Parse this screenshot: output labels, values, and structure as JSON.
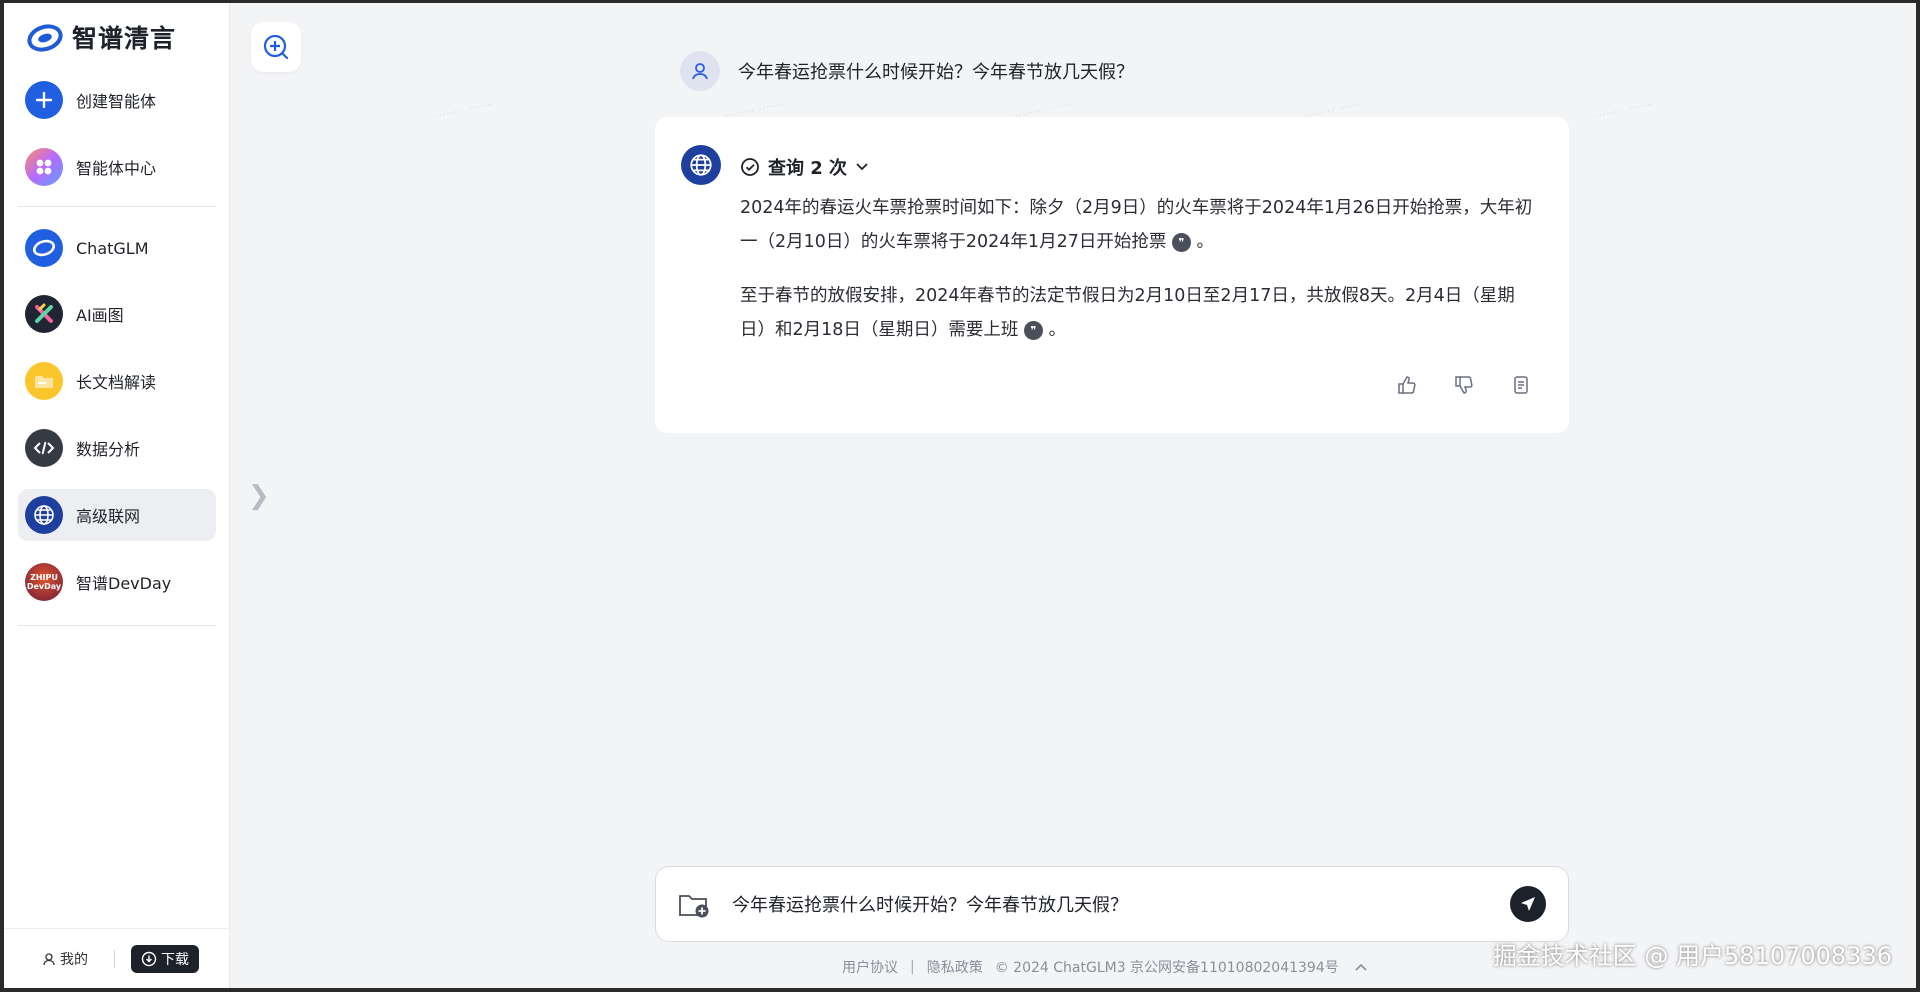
{
  "app": {
    "logo_text": "智谱清言"
  },
  "sidebar": {
    "items": [
      {
        "label": "创建智能体",
        "icon": "plus-icon"
      },
      {
        "label": "智能体中心",
        "icon": "agent-center-icon"
      },
      {
        "label": "ChatGLM",
        "icon": "chatglm-icon"
      },
      {
        "label": "AI画图",
        "icon": "ai-draw-icon"
      },
      {
        "label": "长文档解读",
        "icon": "folder-icon"
      },
      {
        "label": "数据分析",
        "icon": "code-icon"
      },
      {
        "label": "高级联网",
        "icon": "globe-icon",
        "active": true
      },
      {
        "label": "智谱DevDay",
        "icon": "devday-icon",
        "badge": "ZHIPU DevDay"
      }
    ],
    "me_label": "我的",
    "download_label": "下载"
  },
  "chat": {
    "user_message": "今年春运抢票什么时候开始？今年春节放几天假？",
    "query_label": "查询 2 次",
    "answer": {
      "para1": "2024年的春运火车票抢票时间如下：除夕（2月9日）的火车票将于2024年1月26日开始抢票，大年初一（2月10日）的火车票将于2024年1月27日开始抢票",
      "para2": "至于春节的放假安排，2024年春节的法定节假日为2月10日至2月17日，共放假8天。2月4日（星期日）和2月18日（星期日）需要上班",
      "end_mark": "。"
    }
  },
  "input": {
    "value": "今年春运抢票什么时候开始？今年春节放几天假？"
  },
  "footer": {
    "agreement": "用户协议",
    "divider": "|",
    "privacy": "隐私政策",
    "copyright": "© 2024 ChatGLM3 京公网安备11010802041394号"
  },
  "signature": "掘金技术社区 @ 用户58107008336",
  "colors": {
    "accent": "#1e3f9e",
    "dark": "#1d2129",
    "background": "#f3f4f6"
  }
}
